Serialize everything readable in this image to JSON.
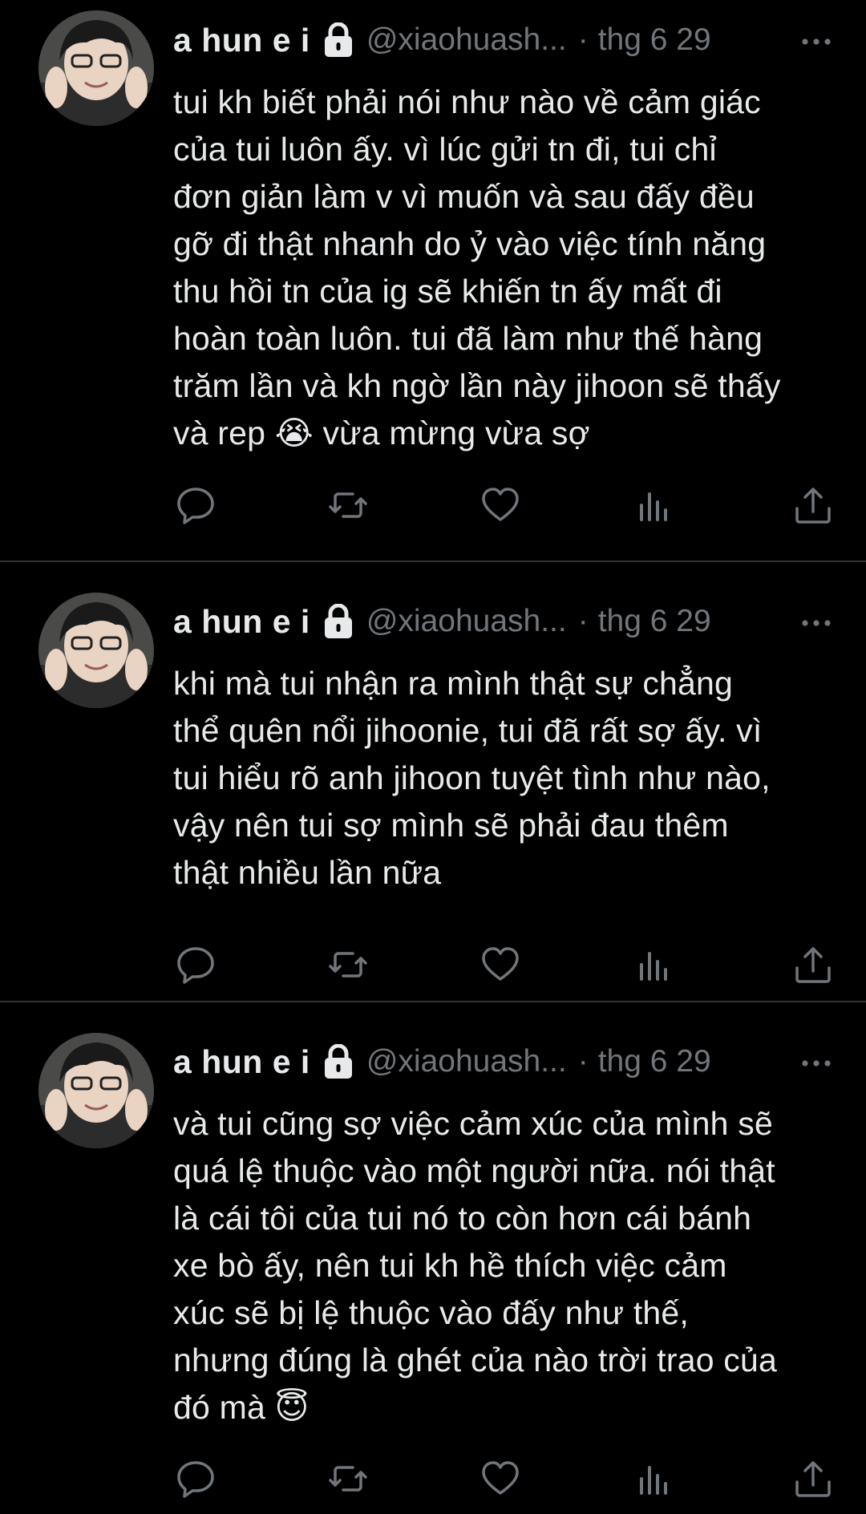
{
  "author": {
    "display_name": "a hun e i",
    "handle": "@xiaohuash...",
    "separator": "·",
    "protected": true
  },
  "tweets": [
    {
      "date": "thg 6 29",
      "text": "tui kh biết phải nói như nào về cảm giác\ncủa tui luôn ấy. vì lúc gửi tn đi, tui chỉ\nđơn giản làm v vì muốn và sau đấy đều\ngỡ đi thật nhanh do ỷ vào việc tính năng\nthu hồi tn của ig sẽ khiến tn ấy mất đi\nhoàn toàn luôn. tui đã làm như thế hàng\ntrăm lần và kh ngờ lần này jihoon sẽ thấy\nvà rep 😭 vừa mừng vừa sợ"
    },
    {
      "date": "thg 6 29",
      "text": "khi mà tui nhận ra mình thật sự chẳng\nthể quên nổi jihoonie, tui đã rất sợ ấy. vì\ntui hiểu rõ anh jihoon tuyệt tình như nào,\nvậy nên tui sợ mình sẽ phải đau thêm\nthật nhiều lần nữa"
    },
    {
      "date": "thg 6 29",
      "text": "và tui cũng sợ việc cảm xúc của mình sẽ\nquá lệ thuộc vào một người nữa. nói thật\nlà cái tôi của tui nó to còn hơn cái bánh\nxe bò ấy, nên tui kh hề thích việc cảm\nxúc sẽ bị lệ thuộc vào đấy như thế,\nnhưng đúng là ghét của nào trời trao của\nđó mà 😇"
    }
  ],
  "icons": {
    "reply": "reply-icon",
    "retweet": "retweet-icon",
    "like": "heart-icon",
    "views": "views-icon",
    "share": "share-icon",
    "lock": "lock-icon",
    "more": "more-icon"
  },
  "colors": {
    "background": "#000000",
    "text": "#e7e9ea",
    "secondary": "#71767b",
    "divider": "#2f3336"
  }
}
